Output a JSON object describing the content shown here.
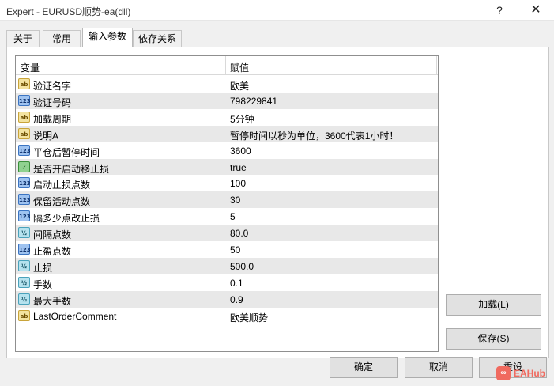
{
  "window": {
    "title": "Expert - EURUSD顺势-ea(dll)",
    "help_label": "?",
    "close_label": "✕"
  },
  "tabs": [
    {
      "label": "关于",
      "active": false
    },
    {
      "label": "常用",
      "active": false
    },
    {
      "label": "输入参数",
      "active": true
    },
    {
      "label": "依存关系",
      "active": false
    }
  ],
  "grid": {
    "columns": [
      "变量",
      "赋值"
    ],
    "rows": [
      {
        "type_icon": "string-icon",
        "type_text": "ab",
        "name": "验证名字",
        "value": "欧美"
      },
      {
        "type_icon": "integer-icon",
        "type_text": "123",
        "name": "验证号码",
        "value": "798229841"
      },
      {
        "type_icon": "string-icon",
        "type_text": "ab",
        "name": "加载周期",
        "value": " 5分钟"
      },
      {
        "type_icon": "string-icon",
        "type_text": "ab",
        "name": "说明A",
        "value": "暂停时间以秒为单位，3600代表1小时！"
      },
      {
        "type_icon": "integer-icon",
        "type_text": "123",
        "name": "平仓后暂停时间",
        "value": "3600"
      },
      {
        "type_icon": "bool-icon",
        "type_text": "✓",
        "name": "是否开启动移止损",
        "value": "true"
      },
      {
        "type_icon": "integer-icon",
        "type_text": "123",
        "name": "启动止损点数",
        "value": "100"
      },
      {
        "type_icon": "integer-icon",
        "type_text": "123",
        "name": "保留活动点数",
        "value": "30"
      },
      {
        "type_icon": "integer-icon",
        "type_text": "123",
        "name": "隔多少点改止损",
        "value": "5"
      },
      {
        "type_icon": "double-icon",
        "type_text": "½",
        "name": "间隔点数",
        "value": "80.0"
      },
      {
        "type_icon": "integer-icon",
        "type_text": "123",
        "name": "止盈点数",
        "value": "50"
      },
      {
        "type_icon": "double-icon",
        "type_text": "½",
        "name": "止损",
        "value": "500.0"
      },
      {
        "type_icon": "double-icon",
        "type_text": "½",
        "name": "手数",
        "value": "0.1"
      },
      {
        "type_icon": "double-icon",
        "type_text": "½",
        "name": "最大手数",
        "value": "0.9"
      },
      {
        "type_icon": "string-icon",
        "type_text": "ab",
        "name": "LastOrderComment",
        "value": "欧美顺势"
      }
    ]
  },
  "buttons": {
    "load": "加载(L)",
    "save": "保存(S)",
    "ok": "确定",
    "cancel": "取消",
    "reset": "重设"
  },
  "watermark": {
    "text": "EAHub"
  }
}
